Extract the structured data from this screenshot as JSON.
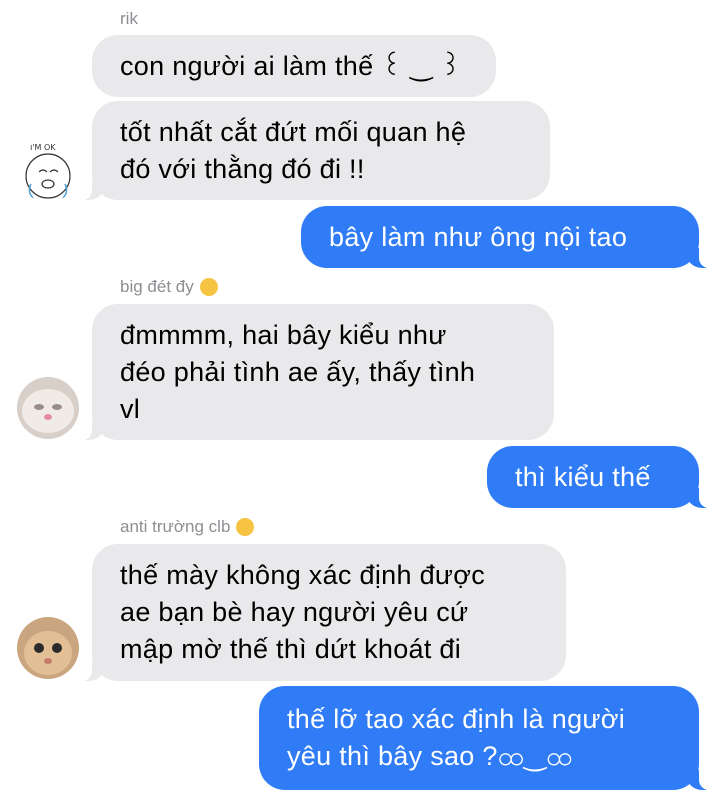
{
  "senders": {
    "rik": "rik",
    "big": "big đét đy",
    "anti": "anti trường clb"
  },
  "messages": [
    "con người ai làm thế ꒰ ‿ ꒱",
    "tốt nhất cắt đứt mối quan hệ\nđó với thằng đó đi !!",
    "bây làm như ông nội tao",
    "đmmmm, hai bây kiểu như\nđéo phải tình ae ấy, thấy tình\nvl",
    "thì kiểu thế",
    "thế mày không xác định được\nae bạn bè hay người yêu cứ\nmập mờ thế thì dứt khoát đi",
    "thế lỡ tao xác định là người\nyêu thì bây sao ?ထ‿ထ"
  ],
  "avatar_rik_text": "I'M OK",
  "colors": {
    "incoming": "#e9e9eb",
    "outgoing": "#2f7cf6",
    "sender_label": "#8e8e93"
  }
}
